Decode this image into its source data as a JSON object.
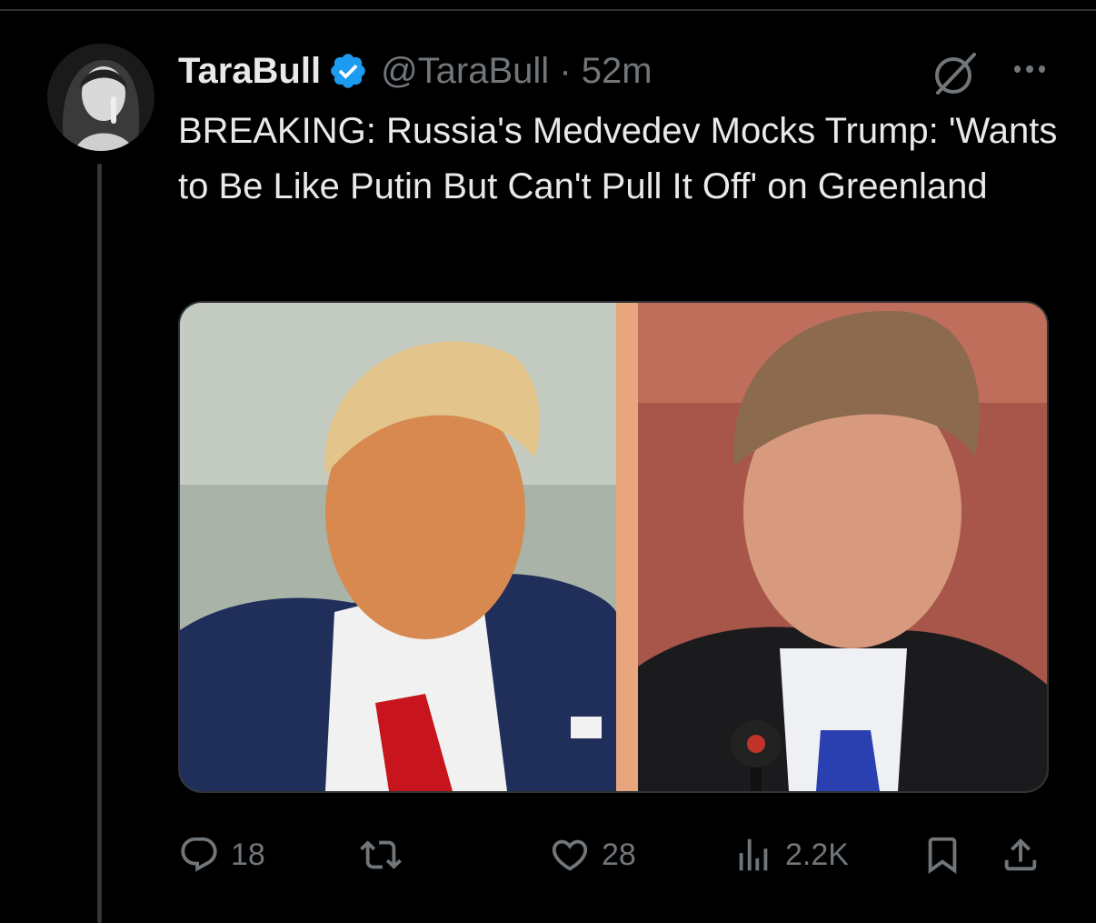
{
  "post": {
    "display_name": "TaraBull",
    "handle": "@TaraBull",
    "separator": "·",
    "time": "52m",
    "text": "BREAKING: Russia's Medvedev Mocks Trump: 'Wants to Be Like Putin But Can't Pull It Off' on Greenland"
  },
  "stats": {
    "replies": "18",
    "reposts": "",
    "likes": "28",
    "views": "2.2K"
  },
  "icons": {
    "verified": "verified-badge-icon",
    "grok": "grok-icon",
    "more": "more-icon",
    "reply": "reply-icon",
    "repost": "repost-icon",
    "like": "heart-icon",
    "views": "views-icon",
    "bookmark": "bookmark-icon",
    "share": "share-icon"
  },
  "colors": {
    "background": "#000000",
    "text": "#e7e9ea",
    "muted": "#71767b",
    "verified": "#1d9bf0",
    "divider": "#2f3336"
  }
}
